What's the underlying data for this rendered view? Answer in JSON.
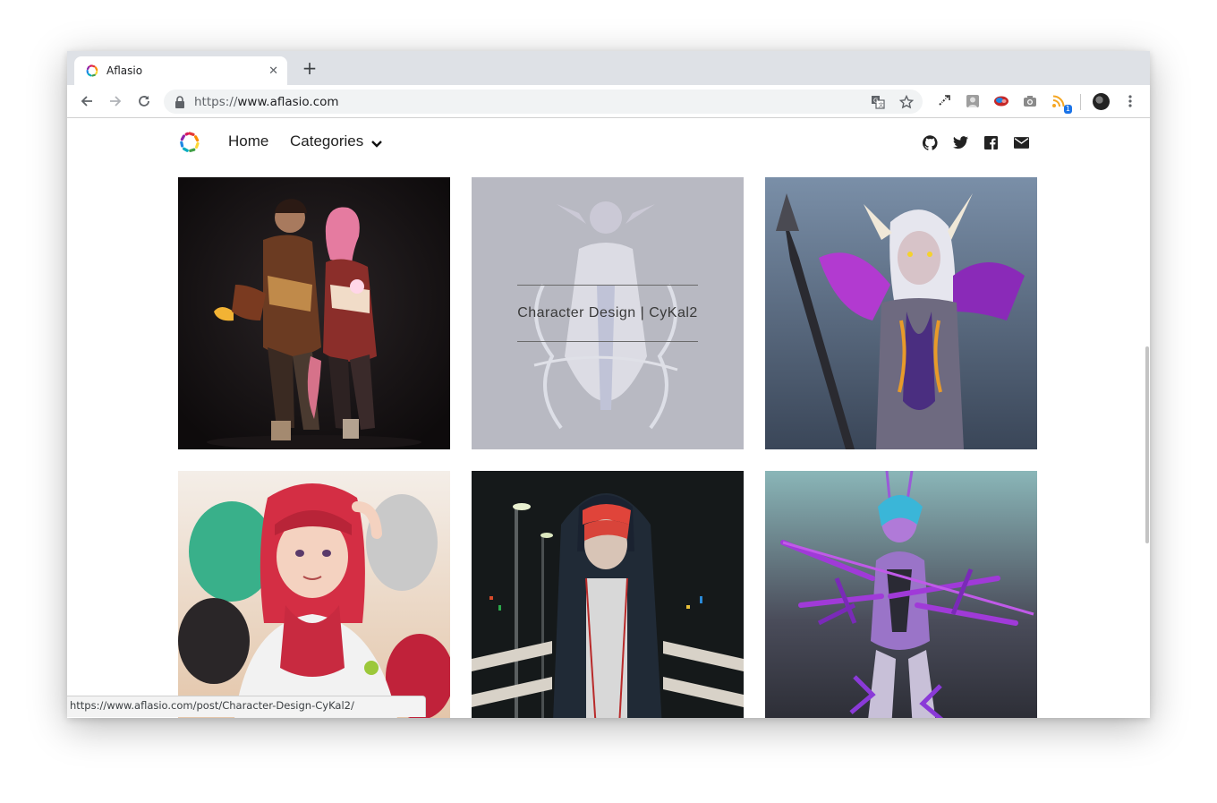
{
  "browser": {
    "tab": {
      "title": "Aflasio",
      "close_glyph": "✕"
    },
    "new_tab_glyph": "+",
    "address": {
      "protocol": "https://",
      "host": "www.aflasio.com"
    },
    "extensions": [
      "translate-icon",
      "bookmark-star-icon",
      "extension-arrow-icon",
      "extension-photo-icon",
      "extension-brain-icon",
      "camera-icon",
      "rss-icon"
    ],
    "rss_badge": "1",
    "status_url": "https://www.aflasio.com/post/Character-Design-CyKal2/"
  },
  "site": {
    "nav": {
      "home": "Home",
      "categories": "Categories"
    },
    "social": [
      "github-icon",
      "twitter-icon",
      "facebook-icon",
      "email-icon"
    ],
    "gallery": [
      {
        "name": "gallery-card-1",
        "caption": ""
      },
      {
        "name": "gallery-card-2",
        "caption": "Character Design | CyKal2"
      },
      {
        "name": "gallery-card-3",
        "caption": ""
      },
      {
        "name": "gallery-card-4",
        "caption": ""
      },
      {
        "name": "gallery-card-5",
        "caption": ""
      },
      {
        "name": "gallery-card-6",
        "caption": ""
      }
    ]
  },
  "colors": {
    "chrome_tabstrip": "#dee1e6",
    "omnibox": "#f1f3f4",
    "link_blue": "#1a73e8"
  }
}
